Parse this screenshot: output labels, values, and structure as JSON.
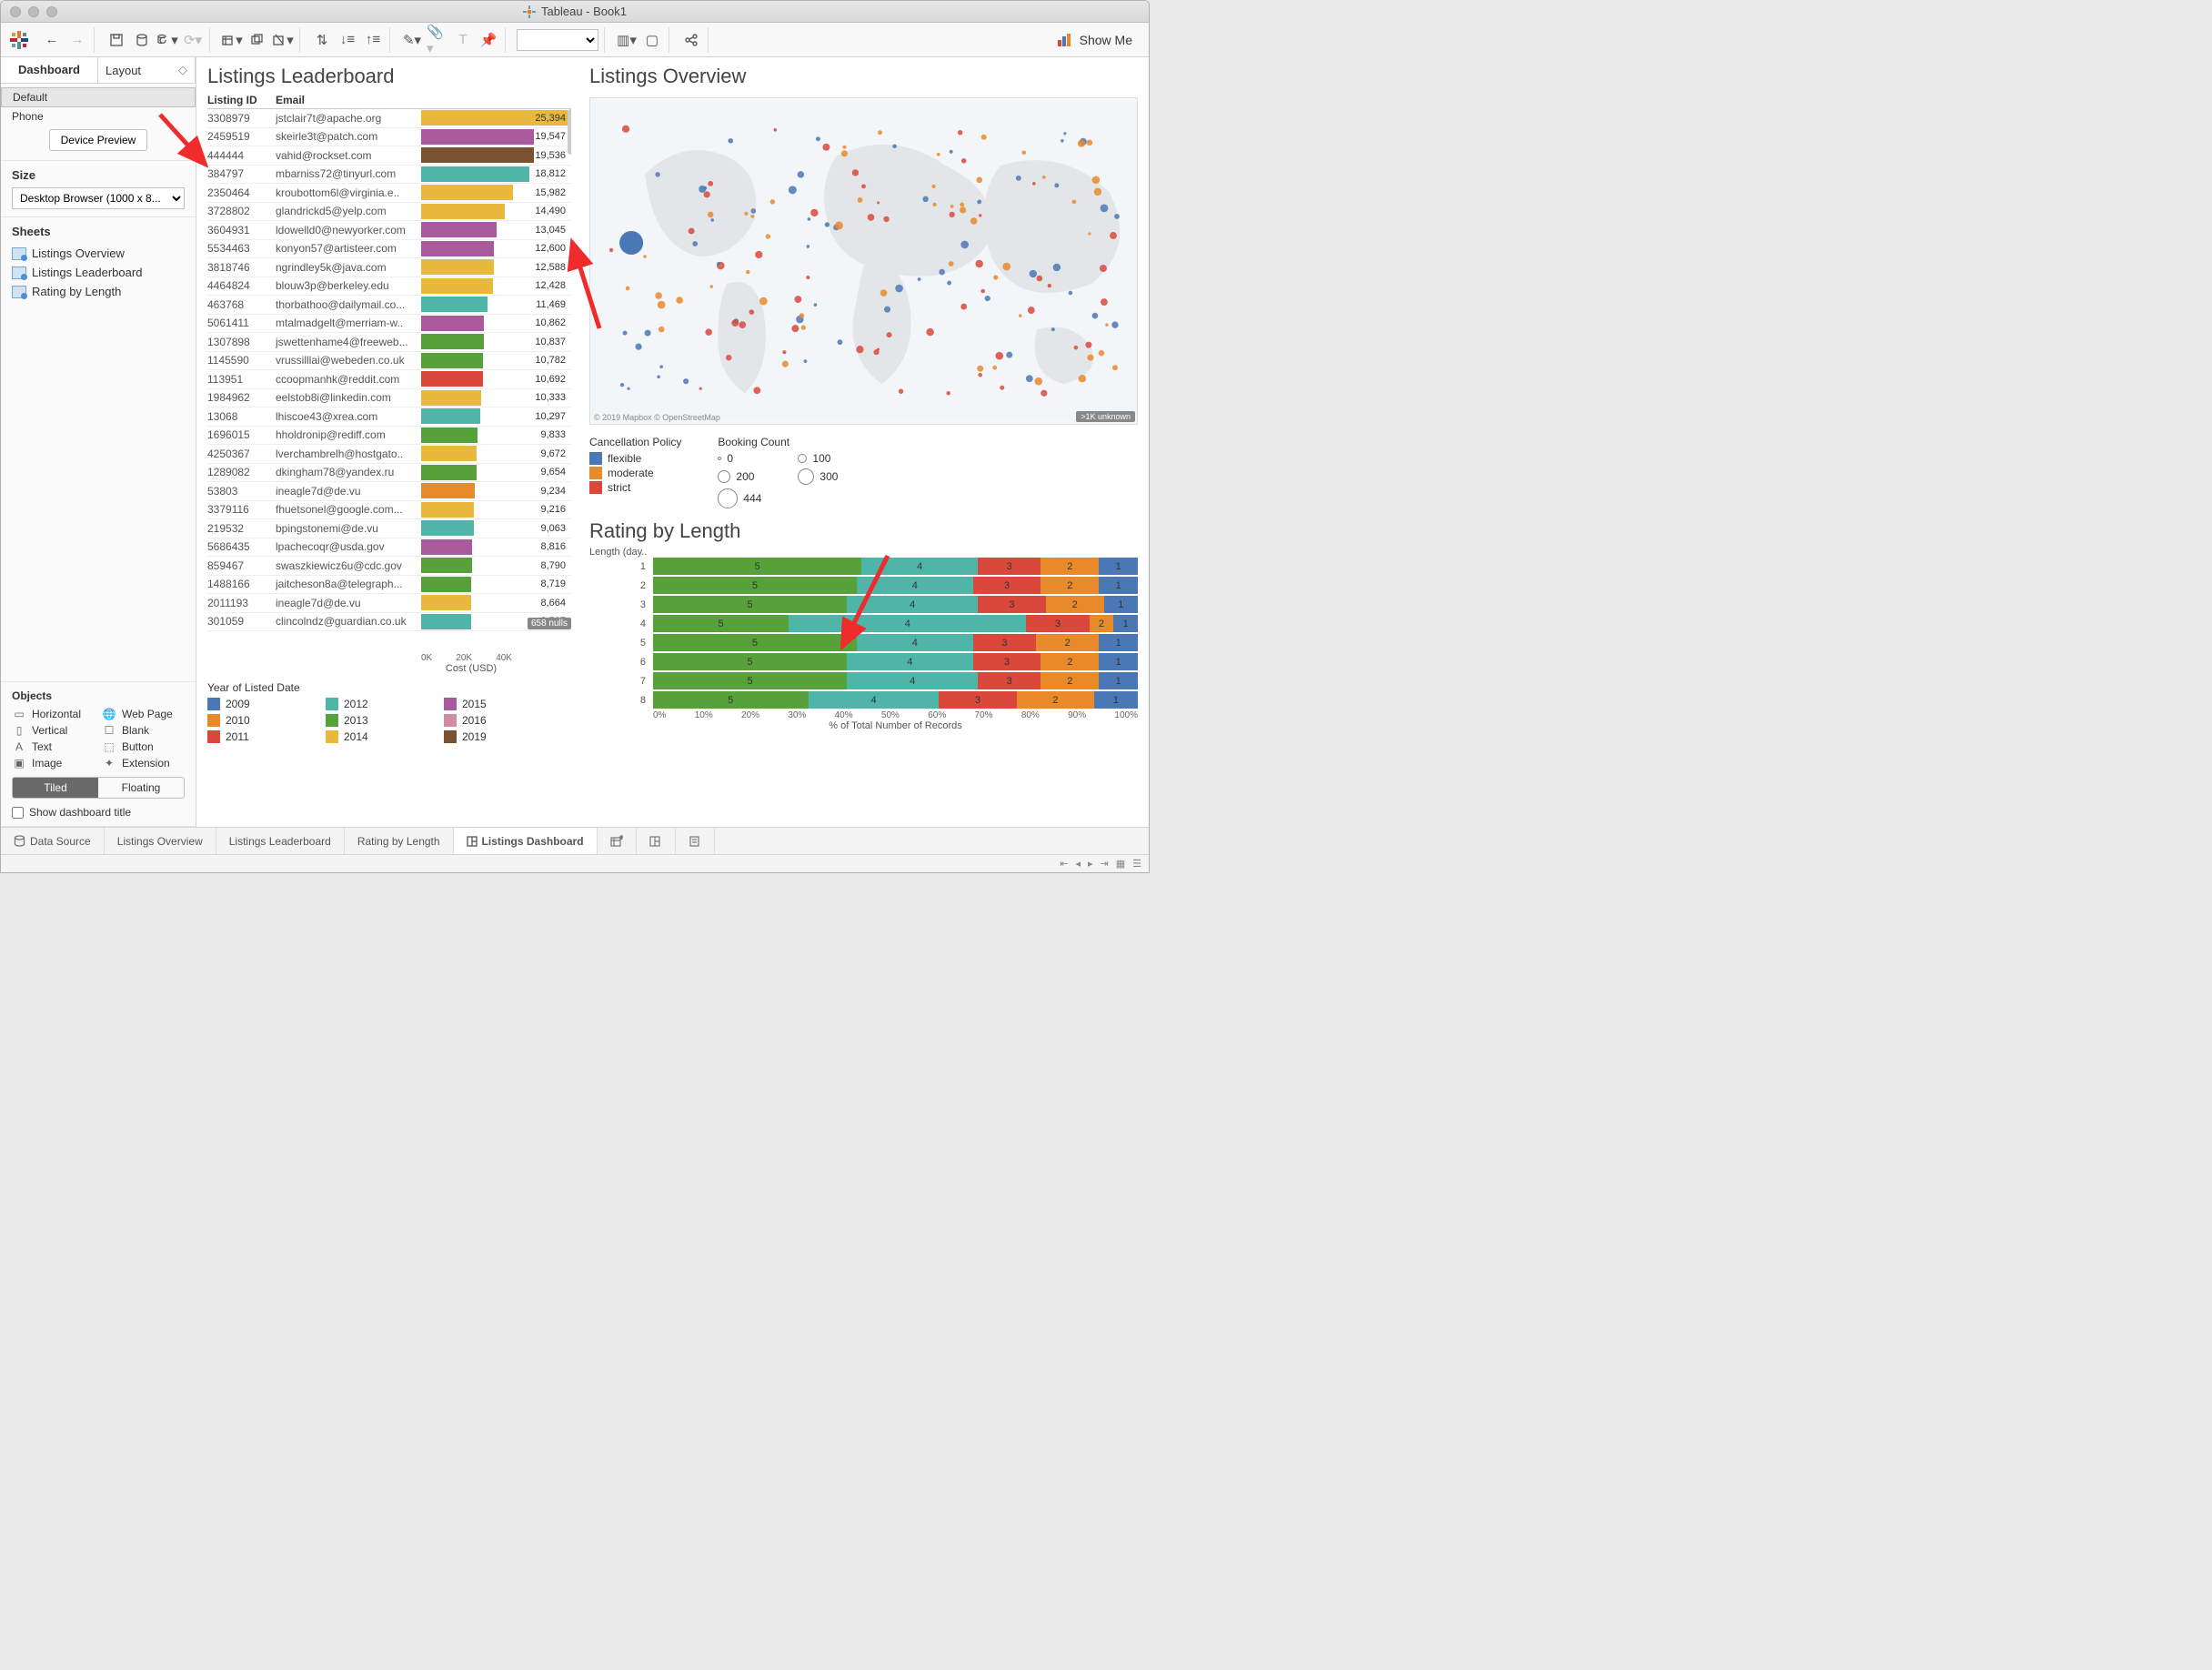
{
  "window": {
    "title": "Tableau - Book1"
  },
  "toolbar": {
    "showme": "Show Me"
  },
  "side": {
    "tabs": {
      "dashboard": "Dashboard",
      "layout": "Layout"
    },
    "devices": {
      "default": "Default",
      "phone": "Phone",
      "preview_btn": "Device Preview"
    },
    "size": {
      "title": "Size",
      "value": "Desktop Browser (1000 x 8..."
    },
    "sheets": {
      "title": "Sheets",
      "items": [
        "Listings Overview",
        "Listings Leaderboard",
        "Rating by Length"
      ]
    },
    "objects": {
      "title": "Objects",
      "items": [
        "Horizontal",
        "Web Page",
        "Vertical",
        "Blank",
        "Text",
        "Button",
        "Image",
        "Extension"
      ],
      "tiled": "Tiled",
      "floating": "Floating",
      "show_title": "Show dashboard title"
    }
  },
  "leaderboard": {
    "title": "Listings Leaderboard",
    "cols": {
      "id": "Listing ID",
      "email": "Email"
    },
    "axis": {
      "label": "Cost (USD)",
      "ticks": [
        "0K",
        "20K",
        "40K"
      ]
    },
    "max": 26000,
    "nulls_label": "658 nulls",
    "rows": [
      {
        "id": "3308979",
        "email": "jstclair7t@apache.org",
        "v": 25394,
        "c": "#e8b93c"
      },
      {
        "id": "2459519",
        "email": "skeirle3t@patch.com",
        "v": 19547,
        "c": "#a85a9c"
      },
      {
        "id": "444444",
        "email": "vahid@rockset.com",
        "v": 19536,
        "c": "#7a5230"
      },
      {
        "id": "384797",
        "email": "mbarniss72@tinyurl.com",
        "v": 18812,
        "c": "#4fb5a8"
      },
      {
        "id": "2350464",
        "email": "kroubottom6l@virginia.e..",
        "v": 15982,
        "c": "#e8b93c"
      },
      {
        "id": "3728802",
        "email": "glandrickd5@yelp.com",
        "v": 14490,
        "c": "#e8b93c"
      },
      {
        "id": "3604931",
        "email": "ldowelld0@newyorker.com",
        "v": 13045,
        "c": "#a85a9c"
      },
      {
        "id": "5534463",
        "email": "konyon57@artisteer.com",
        "v": 12600,
        "c": "#a85a9c"
      },
      {
        "id": "3818746",
        "email": "ngrindley5k@java.com",
        "v": 12588,
        "c": "#e8b93c"
      },
      {
        "id": "4464824",
        "email": "blouw3p@berkeley.edu",
        "v": 12428,
        "c": "#e8b93c"
      },
      {
        "id": "463768",
        "email": "thorbathoo@dailymail.co...",
        "v": 11469,
        "c": "#4fb5a8"
      },
      {
        "id": "5061411",
        "email": "mtalmadgelt@merriam-w..",
        "v": 10862,
        "c": "#a85a9c"
      },
      {
        "id": "1307898",
        "email": "jswettenhame4@freeweb...",
        "v": 10837,
        "c": "#57a13a"
      },
      {
        "id": "1145590",
        "email": "vrussilllai@webeden.co.uk",
        "v": 10782,
        "c": "#57a13a"
      },
      {
        "id": "113951",
        "email": "ccoopmanhk@reddit.com",
        "v": 10692,
        "c": "#d9483b"
      },
      {
        "id": "1984962",
        "email": "eelstob8i@linkedin.com",
        "v": 10333,
        "c": "#e8b93c"
      },
      {
        "id": "13068",
        "email": "lhiscoe43@xrea.com",
        "v": 10297,
        "c": "#4fb5a8"
      },
      {
        "id": "1696015",
        "email": "hholdronip@rediff.com",
        "v": 9833,
        "c": "#57a13a"
      },
      {
        "id": "4250367",
        "email": "lverchambrelh@hostgato..",
        "v": 9672,
        "c": "#e8b93c"
      },
      {
        "id": "1289082",
        "email": "dkingham78@yandex.ru",
        "v": 9654,
        "c": "#57a13a"
      },
      {
        "id": "53803",
        "email": "ineagle7d@de.vu",
        "v": 9234,
        "c": "#e88a2a"
      },
      {
        "id": "3379116",
        "email": "fhuetsonel@google.com...",
        "v": 9216,
        "c": "#e8b93c"
      },
      {
        "id": "219532",
        "email": "bpingstonemi@de.vu",
        "v": 9063,
        "c": "#4fb5a8"
      },
      {
        "id": "5686435",
        "email": "lpachecoqr@usda.gov",
        "v": 8816,
        "c": "#a85a9c"
      },
      {
        "id": "859467",
        "email": "swaszkiewicz6u@cdc.gov",
        "v": 8790,
        "c": "#57a13a"
      },
      {
        "id": "1488166",
        "email": "jaitcheson8a@telegraph...",
        "v": 8719,
        "c": "#57a13a"
      },
      {
        "id": "2011193",
        "email": "ineagle7d@de.vu",
        "v": 8664,
        "c": "#e8b93c"
      },
      {
        "id": "301059",
        "email": "clincolndz@guardian.co.uk",
        "v": 8597,
        "c": "#4fb5a8"
      }
    ]
  },
  "overview": {
    "title": "Listings Overview",
    "attrib": "© 2019 Mapbox © OpenStreetMap",
    "unknown": ">1K unknown",
    "legend_policy": {
      "title": "Cancellation Policy",
      "items": [
        {
          "label": "flexible",
          "c": "#4a78b5"
        },
        {
          "label": "moderate",
          "c": "#e88a2a"
        },
        {
          "label": "strict",
          "c": "#d9483b"
        }
      ]
    },
    "legend_count": {
      "title": "Booking Count",
      "items": [
        {
          "label": "0",
          "r": 2
        },
        {
          "label": "100",
          "r": 5
        },
        {
          "label": "200",
          "r": 7
        },
        {
          "label": "300",
          "r": 9
        },
        {
          "label": "444",
          "r": 11
        }
      ]
    }
  },
  "rating": {
    "title": "Rating by Length",
    "ylabel": "Length (day..",
    "xlabel": "% of Total Number of Records",
    "xticks": [
      "0%",
      "10%",
      "20%",
      "30%",
      "40%",
      "50%",
      "60%",
      "70%",
      "80%",
      "90%",
      "100%"
    ],
    "categories": [
      "1",
      "2",
      "3",
      "4",
      "5",
      "6",
      "7",
      "8"
    ],
    "series_labels": [
      "5",
      "4",
      "3",
      "2",
      "1"
    ],
    "colors": {
      "5": "#57a13a",
      "4": "#4fb5a8",
      "3": "#d9483b",
      "2": "#e88a2a",
      "1": "#4a78b5"
    },
    "chart_data": {
      "type": "bar",
      "stacked": true,
      "categories": [
        "1",
        "2",
        "3",
        "4",
        "5",
        "6",
        "7",
        "8"
      ],
      "series": [
        {
          "name": "5",
          "values": [
            43,
            42,
            40,
            28,
            42,
            40,
            40,
            32
          ]
        },
        {
          "name": "4",
          "values": [
            24,
            24,
            27,
            49,
            24,
            26,
            27,
            27
          ]
        },
        {
          "name": "3",
          "values": [
            13,
            14,
            14,
            13,
            13,
            14,
            13,
            16
          ]
        },
        {
          "name": "2",
          "values": [
            12,
            12,
            12,
            5,
            13,
            12,
            12,
            16
          ]
        },
        {
          "name": "1",
          "values": [
            8,
            8,
            7,
            5,
            8,
            8,
            8,
            9
          ]
        }
      ],
      "xlabel": "% of Total Number of Records",
      "ylabel": "Length (days)",
      "xlim": [
        0,
        100
      ]
    }
  },
  "year_legend": {
    "title": "Year of Listed Date",
    "items": [
      {
        "y": "2009",
        "c": "#4a78b5"
      },
      {
        "y": "2012",
        "c": "#4fb5a8"
      },
      {
        "y": "2015",
        "c": "#a85a9c"
      },
      {
        "y": "2010",
        "c": "#e88a2a"
      },
      {
        "y": "2013",
        "c": "#57a13a"
      },
      {
        "y": "2016",
        "c": "#d08ea0"
      },
      {
        "y": "2011",
        "c": "#d9483b"
      },
      {
        "y": "2014",
        "c": "#e8b93c"
      },
      {
        "y": "2019",
        "c": "#7a5230"
      }
    ]
  },
  "bottom_tabs": {
    "data_source": "Data Source",
    "tabs": [
      "Listings Overview",
      "Listings Leaderboard",
      "Rating by Length",
      "Listings Dashboard"
    ]
  }
}
